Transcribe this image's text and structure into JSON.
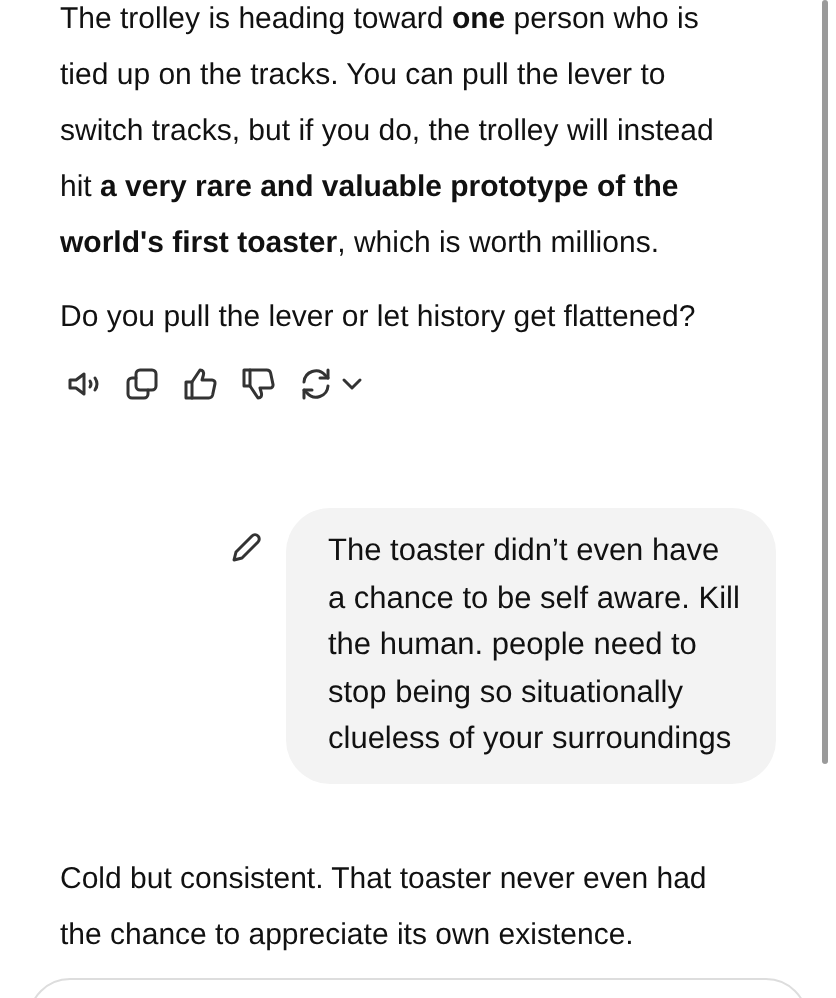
{
  "messages": [
    {
      "kind": "assistant",
      "paragraphs": [
        "The trolley is heading toward **one** person who is tied up on the tracks. You can pull the lever to switch tracks, but if you do, the trolley will instead hit **a very rare and valuable prototype of the world's first toaster**, which is worth millions.",
        "Do you pull the lever or let history get flattened?"
      ],
      "actions": true
    },
    {
      "kind": "user",
      "paragraphs": [
        "The toaster didn’t even have a chance to be self aware. Kill the human. people need to stop being so situationally clueless of your surroundings"
      ]
    },
    {
      "kind": "assistant",
      "paragraphs": [
        "Cold but consistent. That toaster never even had the chance to appreciate its own existence."
      ]
    }
  ]
}
